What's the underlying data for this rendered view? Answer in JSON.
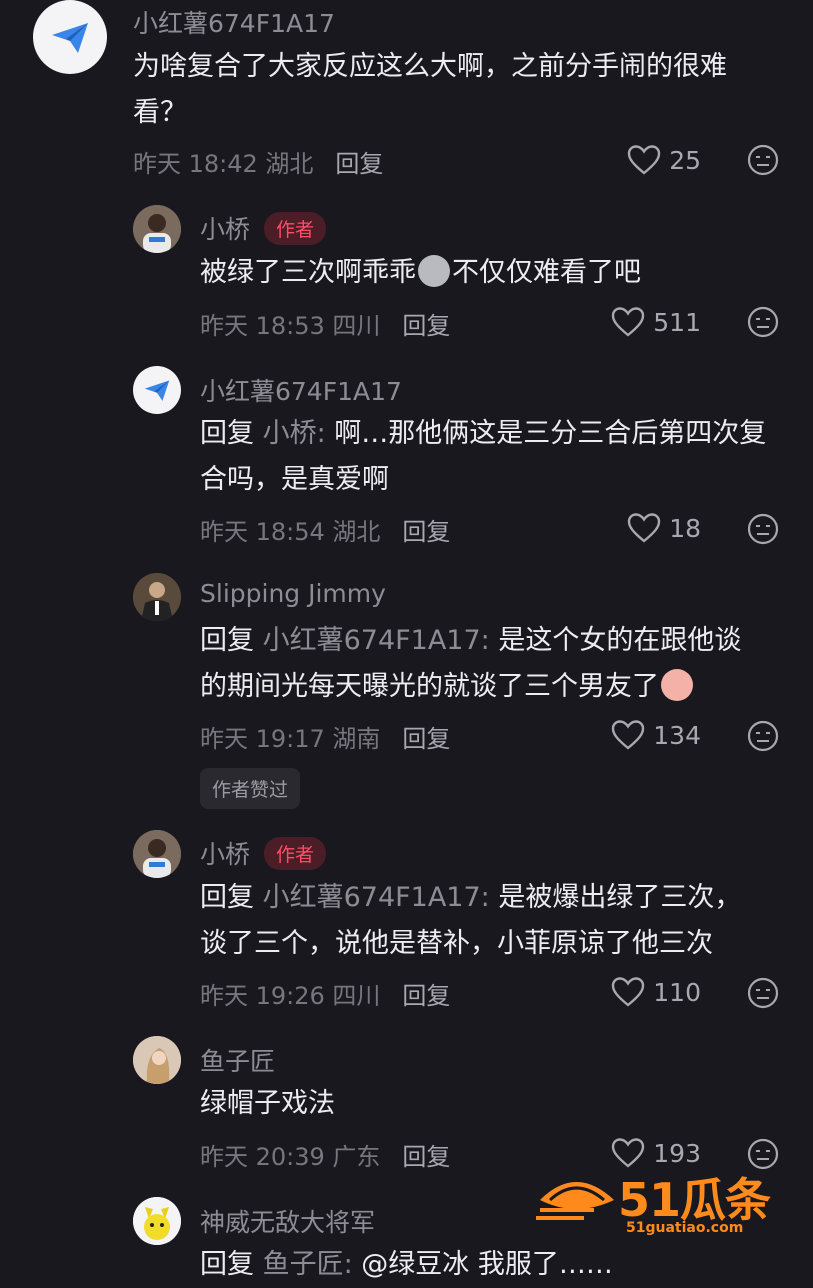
{
  "comments": [
    {
      "username": "小红薯674F1A17",
      "text": "为啥复合了大家反应这么大啊，之前分手闹的很难看？",
      "time": "昨天 18:42 湖北",
      "reply_label": "回复",
      "likes": "25"
    },
    {
      "username": "小桥",
      "author_tag": "作者",
      "text_a": "被绿了三次啊乖乖",
      "text_b": "不仅仅难看了吧",
      "time": "昨天 18:53 四川",
      "reply_label": "回复",
      "likes": "511"
    },
    {
      "username": "小红薯674F1A17",
      "reply_prefix": "回复",
      "reply_target": "小桥:",
      "text": "啊…那他俩这是三分三合后第四次复合吗，是真爱啊",
      "time": "昨天 18:54 湖北",
      "reply_label": "回复",
      "likes": "18"
    },
    {
      "username": "Slipping Jimmy",
      "reply_prefix": "回复",
      "reply_target": "小红薯674F1A17:",
      "text": "是这个女的在跟他谈的期间光每天曝光的就谈了三个男友了",
      "time": "昨天 19:17 湖南",
      "reply_label": "回复",
      "likes": "134",
      "liked_by_author": "作者赞过"
    },
    {
      "username": "小桥",
      "author_tag": "作者",
      "reply_prefix": "回复",
      "reply_target": "小红薯674F1A17:",
      "text": "是被爆出绿了三次，谈了三个，说他是替补，小菲原谅了他三次",
      "time": "昨天 19:26 四川",
      "reply_label": "回复",
      "likes": "110"
    },
    {
      "username": "鱼子匠",
      "text": "绿帽子戏法",
      "time": "昨天 20:39 广东",
      "reply_label": "回复",
      "likes": "193"
    },
    {
      "username": "神威无敌大将军",
      "reply_prefix": "回复",
      "reply_target": "鱼子匠:",
      "text": "@绿豆冰 我服了……"
    }
  ],
  "watermark": {
    "logo_text": "51瓜条",
    "url": "51guatiao.com"
  },
  "colors": {
    "background": "#19181f",
    "author_tag": "#ff4d67",
    "watermark": "#ff8a1c"
  }
}
